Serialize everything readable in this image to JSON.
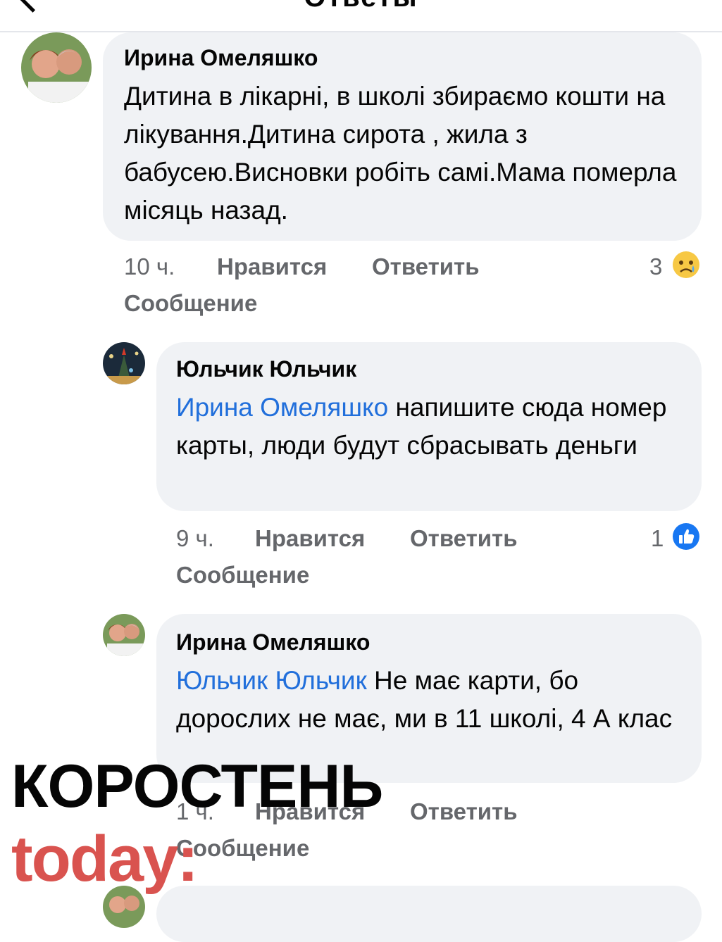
{
  "header": {
    "title": "Ответы"
  },
  "comments": [
    {
      "author": "Ирина Омеляшко",
      "text": "Дитина в лікарні, в школі збираємо кошти на лікування.Дитина сирота , жила з бабусею.Висновки робіть самі.Мама померла місяць назад.",
      "mention": "",
      "time": "10 ч.",
      "like_label": "Нравится",
      "reply_label": "Ответить",
      "message_label": "Сообщение",
      "reaction_count": "3",
      "reaction": "sad-emoji"
    },
    {
      "author": "Юльчик Юльчик",
      "mention": "Ирина Омеляшко",
      "text": " напишите сюда номер карты, люди будут сбрасывать деньги",
      "time": "9 ч.",
      "like_label": "Нравится",
      "reply_label": "Ответить",
      "message_label": "Сообщение",
      "reaction_count": "1",
      "reaction": "like-emoji"
    },
    {
      "author": "Ирина Омеляшко",
      "mention": "Юльчик Юльчик",
      "text": " Не має карти, бо дорослих не має, ми в 11 школі, 4 А клас",
      "time": "1 ч.",
      "like_label": "Нравится",
      "reply_label": "Ответить",
      "message_label": "Сообщение"
    }
  ],
  "watermark": {
    "line1": "КОРОСТЕНЬ",
    "line2": "today:"
  },
  "colors": {
    "mention": "#216fdb",
    "bubble": "#f0f2f5",
    "meta": "#65676b",
    "brand_red": "#d9534f",
    "like_blue": "#1877f2"
  }
}
